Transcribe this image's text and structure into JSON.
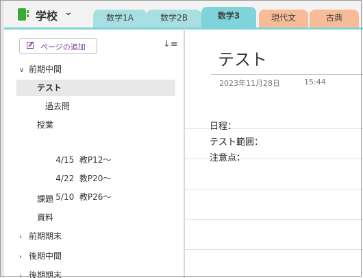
{
  "notebook": {
    "title": "学校"
  },
  "tabs": [
    {
      "label": "数学1A"
    },
    {
      "label": "数学2B"
    },
    {
      "label": "数学3"
    },
    {
      "label": "現代文"
    },
    {
      "label": "古典"
    }
  ],
  "sidebar": {
    "add_page_label": "ページの追加",
    "items": [
      {
        "label": "前期中間"
      },
      {
        "label": "テスト"
      },
      {
        "label": "過去問"
      },
      {
        "label": "授業"
      },
      {
        "label": "4/15  教P12～"
      },
      {
        "label": "4/22  教P20～"
      },
      {
        "label": "5/10  教P26～"
      },
      {
        "label": "課題"
      },
      {
        "label": "資料"
      },
      {
        "label": "前期期末"
      },
      {
        "label": "後期中間"
      },
      {
        "label": "後期期末"
      }
    ]
  },
  "page": {
    "title": "テスト",
    "date": "2023年11月28日",
    "time": "15:44",
    "lines": [
      "日程：",
      "テスト範囲：",
      "注意点："
    ]
  },
  "colors": {
    "tab_math": "#a8dfe3",
    "tab_math_active": "#7fd3da",
    "tab_japanese": "#f7bb97",
    "notebook_icon": "#3aa935",
    "add_page_text": "#7b3fa6"
  }
}
